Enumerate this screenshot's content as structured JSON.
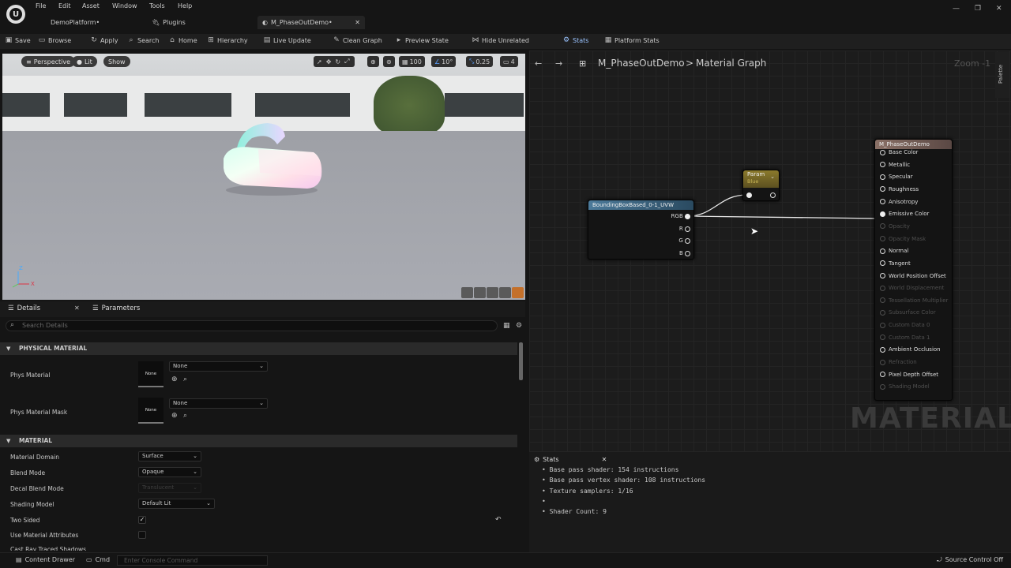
{
  "menubar": {
    "logo": "U",
    "items": [
      "File",
      "Edit",
      "Asset",
      "Window",
      "Tools",
      "Help"
    ],
    "tabs": [
      "DemoPlatform•",
      "Plugins",
      "M_PhaseOutDemo•"
    ],
    "window_buttons": [
      "—",
      "❐",
      "✕"
    ]
  },
  "toolbar": {
    "save": "Save",
    "browse": "Browse",
    "apply": "Apply",
    "search": "Search",
    "home": "Home",
    "hierarchy": "Hierarchy",
    "live_update": "Live Update",
    "clean_graph": "Clean Graph",
    "preview_state": "Preview State",
    "hide_unrelated": "Hide Unrelated",
    "stats": "Stats",
    "platform_stats": "Platform Stats"
  },
  "viewport": {
    "perspective": "Perspective",
    "lit": "Lit",
    "show": "Show",
    "grid_snap": "100",
    "rot_snap": "10°",
    "scale_snap": "0.25",
    "cam_speed": "4",
    "axis_z": "Z",
    "axis_x": "X"
  },
  "details": {
    "tab_details": "Details",
    "tab_parameters": "Parameters",
    "search_placeholder": "Search Details",
    "section_physical": "PHYSICAL MATERIAL",
    "phys_material_label": "Phys Material",
    "phys_material_value": "None",
    "phys_material_thumb": "None",
    "phys_mask_label": "Phys Material Mask",
    "phys_mask_value": "None",
    "phys_mask_thumb": "None",
    "section_material": "MATERIAL",
    "material_domain_label": "Material Domain",
    "material_domain_value": "Surface",
    "blend_mode_label": "Blend Mode",
    "blend_mode_value": "Opaque",
    "decal_blend_label": "Decal Blend Mode",
    "decal_blend_value": "Translucent",
    "shading_model_label": "Shading Model",
    "shading_model_value": "Default Lit",
    "two_sided_label": "Two Sided",
    "two_sided_checked": true,
    "use_attrs_label": "Use Material Attributes",
    "use_attrs_checked": false,
    "cut_label": "Cast Ray Traced Shadows"
  },
  "graph": {
    "breadcrumb_asset": "M_PhaseOutDemo",
    "breadcrumb_sep": ">",
    "breadcrumb_graph": "Material Graph",
    "zoom": "Zoom -1",
    "palette": "Palette",
    "watermark": "MATERIAL",
    "bbox_node": {
      "title": "BoundingBoxBased_0-1_UVW",
      "pins": [
        "RGB",
        "R",
        "G",
        "B"
      ]
    },
    "param_node": {
      "title": "Param",
      "subtitle": "Blue"
    },
    "material_node": {
      "title": "M_PhaseOutDemo",
      "inputs": [
        {
          "label": "Base Color",
          "enabled": true
        },
        {
          "label": "Metallic",
          "enabled": true
        },
        {
          "label": "Specular",
          "enabled": true
        },
        {
          "label": "Roughness",
          "enabled": true
        },
        {
          "label": "Anisotropy",
          "enabled": true
        },
        {
          "label": "Emissive Color",
          "enabled": true
        },
        {
          "label": "Opacity",
          "enabled": false
        },
        {
          "label": "Opacity Mask",
          "enabled": false
        },
        {
          "label": "Normal",
          "enabled": true
        },
        {
          "label": "Tangent",
          "enabled": true
        },
        {
          "label": "World Position Offset",
          "enabled": true
        },
        {
          "label": "World Displacement",
          "enabled": false
        },
        {
          "label": "Tessellation Multiplier",
          "enabled": false
        },
        {
          "label": "Subsurface Color",
          "enabled": false
        },
        {
          "label": "Custom Data 0",
          "enabled": false
        },
        {
          "label": "Custom Data 1",
          "enabled": false
        },
        {
          "label": "Ambient Occlusion",
          "enabled": true
        },
        {
          "label": "Refraction",
          "enabled": false
        },
        {
          "label": "Pixel Depth Offset",
          "enabled": true
        },
        {
          "label": "Shading Model",
          "enabled": false
        }
      ]
    }
  },
  "stats": {
    "title": "Stats",
    "lines": [
      "Base pass shader: 154 instructions",
      "Base pass vertex shader: 108 instructions",
      "Texture samplers: 1/16",
      "",
      "Shader Count: 9"
    ]
  },
  "statusbar": {
    "content_drawer": "Content Drawer",
    "cmd": "Cmd",
    "console_placeholder": "Enter Console Command",
    "source_control": "Source Control Off"
  }
}
